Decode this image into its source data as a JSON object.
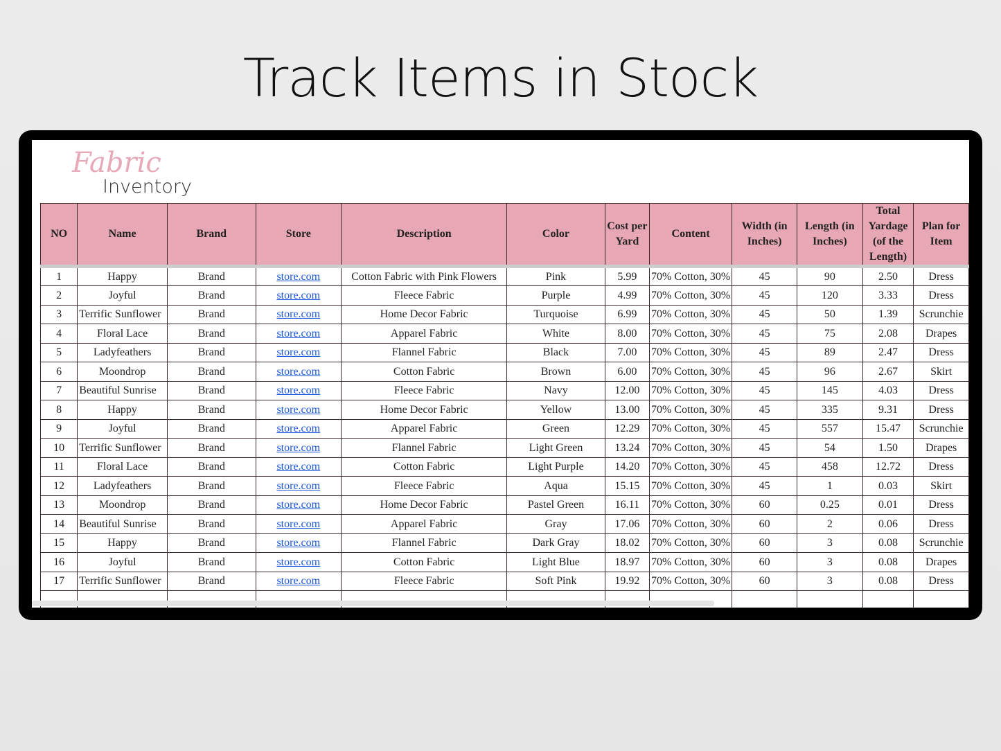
{
  "page_title": "Track Items in Stock",
  "logo": {
    "script": "Fabric",
    "word": "Inventory"
  },
  "columns": [
    "NO",
    "Name",
    "Brand",
    "Store",
    "Description",
    "Color",
    "Cost per Yard",
    "Content",
    "Width (in Inches)",
    "Length (in Inches)",
    "Total Yardage (of the Length)",
    "Plan for Item"
  ],
  "rows": [
    [
      "1",
      "Happy",
      "Brand",
      "store.com",
      "Cotton Fabric with Pink Flowers",
      "Pink",
      "5.99",
      "70% Cotton, 30%",
      "45",
      "90",
      "2.50",
      "Dress"
    ],
    [
      "2",
      "Joyful",
      "Brand",
      "store.com",
      "Fleece Fabric",
      "Purple",
      "4.99",
      "70% Cotton, 30%",
      "45",
      "120",
      "3.33",
      "Dress"
    ],
    [
      "3",
      "Terrific Sunflower",
      "Brand",
      "store.com",
      "Home Decor Fabric",
      "Turquoise",
      "6.99",
      "70% Cotton, 30%",
      "45",
      "50",
      "1.39",
      "Scrunchie"
    ],
    [
      "4",
      "Floral Lace",
      "Brand",
      "store.com",
      "Apparel Fabric",
      "White",
      "8.00",
      "70% Cotton, 30%",
      "45",
      "75",
      "2.08",
      "Drapes"
    ],
    [
      "5",
      "Ladyfeathers",
      "Brand",
      "store.com",
      "Flannel Fabric",
      "Black",
      "7.00",
      "70% Cotton, 30%",
      "45",
      "89",
      "2.47",
      "Dress"
    ],
    [
      "6",
      "Moondrop",
      "Brand",
      "store.com",
      "Cotton Fabric",
      "Brown",
      "6.00",
      "70% Cotton, 30%",
      "45",
      "96",
      "2.67",
      "Skirt"
    ],
    [
      "7",
      "Beautiful Sunrise",
      "Brand",
      "store.com",
      "Fleece Fabric",
      "Navy",
      "12.00",
      "70% Cotton, 30%",
      "45",
      "145",
      "4.03",
      "Dress"
    ],
    [
      "8",
      "Happy",
      "Brand",
      "store.com",
      "Home Decor Fabric",
      "Yellow",
      "13.00",
      "70% Cotton, 30%",
      "45",
      "335",
      "9.31",
      "Dress"
    ],
    [
      "9",
      "Joyful",
      "Brand",
      "store.com",
      "Apparel Fabric",
      "Green",
      "12.29",
      "70% Cotton, 30%",
      "45",
      "557",
      "15.47",
      "Scrunchie"
    ],
    [
      "10",
      "Terrific Sunflower",
      "Brand",
      "store.com",
      "Flannel Fabric",
      "Light Green",
      "13.24",
      "70% Cotton, 30%",
      "45",
      "54",
      "1.50",
      "Drapes"
    ],
    [
      "11",
      "Floral Lace",
      "Brand",
      "store.com",
      "Cotton Fabric",
      "Light Purple",
      "14.20",
      "70% Cotton, 30%",
      "45",
      "458",
      "12.72",
      "Dress"
    ],
    [
      "12",
      "Ladyfeathers",
      "Brand",
      "store.com",
      "Fleece Fabric",
      "Aqua",
      "15.15",
      "70% Cotton, 30%",
      "45",
      "1",
      "0.03",
      "Skirt"
    ],
    [
      "13",
      "Moondrop",
      "Brand",
      "store.com",
      "Home Decor Fabric",
      "Pastel Green",
      "16.11",
      "70% Cotton, 30%",
      "60",
      "0.25",
      "0.01",
      "Dress"
    ],
    [
      "14",
      "Beautiful Sunrise",
      "Brand",
      "store.com",
      "Apparel Fabric",
      "Gray",
      "17.06",
      "70% Cotton, 30%",
      "60",
      "2",
      "0.06",
      "Dress"
    ],
    [
      "15",
      "Happy",
      "Brand",
      "store.com",
      "Flannel Fabric",
      "Dark Gray",
      "18.02",
      "70% Cotton, 30%",
      "60",
      "3",
      "0.08",
      "Scrunchie"
    ],
    [
      "16",
      "Joyful",
      "Brand",
      "store.com",
      "Cotton Fabric",
      "Light Blue",
      "18.97",
      "70% Cotton, 30%",
      "60",
      "3",
      "0.08",
      "Drapes"
    ],
    [
      "17",
      "Terrific Sunflower",
      "Brand",
      "store.com",
      "Fleece Fabric",
      "Soft Pink",
      "19.92",
      "70% Cotton, 30%",
      "60",
      "3",
      "0.08",
      "Dress"
    ]
  ],
  "colors": {
    "header": "#e8a7b4",
    "link": "#1a56db",
    "frame": "#000000"
  }
}
